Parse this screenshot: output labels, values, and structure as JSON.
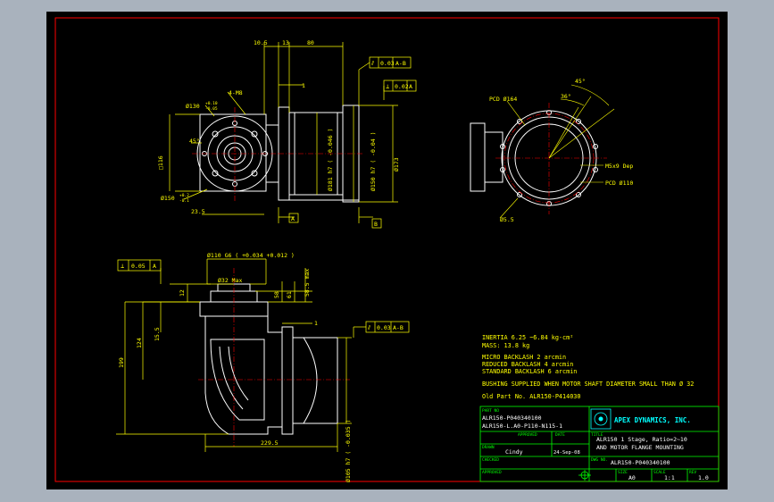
{
  "colors": {
    "background": "#a9b2bd",
    "sheet": "#000000",
    "border": "#ff0000",
    "line": "#ffffff",
    "dimension": "#ffff00",
    "center": "#ff0000",
    "titleblock": "#00ff00",
    "logo": "#00ffff"
  },
  "top_view": {
    "dims": {
      "d_10_5": "10.5",
      "d_13": "13",
      "d_80": "80",
      "d_1": "1",
      "d_4_m8": "4-M8",
      "d_130": "Ø130",
      "d_130_tol_top": "+0.10",
      "d_130_tol_bot": "-0.05",
      "d_45": "45°",
      "d_116": "□116",
      "d_150": "Ø150",
      "d_150_tol_top": "+0.2",
      "d_150_tol_bot": "-0.1",
      "d_23_5": "23.5",
      "d_181_h7": "Ø181 h7 ( -0.046 )",
      "d_150_h7": "Ø150 h7 ( -0.04 )",
      "d_173": "Ø173"
    },
    "fcf_1": {
      "symbol": "⫽",
      "value": "0.03",
      "ref": "A-B"
    },
    "fcf_2": {
      "symbol": "⊥",
      "value": "0.02",
      "ref": "A"
    },
    "datum_a": "A",
    "datum_b": "B"
  },
  "side_view": {
    "dims": {
      "pcd_164": "PCD Ø164",
      "ang_45": "45°",
      "ang_36": "36°",
      "m5": "M5x9 Dep",
      "pcd_110": "PCD Ø110",
      "d_5_5": "Ø5.5"
    }
  },
  "bottom_view": {
    "dims": {
      "d_110_g6": "Ø110 G6 ( +0.034 +0.012 )",
      "d_32": "Ø32 Max",
      "d_58": "58",
      "d_61": "61",
      "d_58_5": "58.5 max",
      "d_12": "12",
      "d_15_5": "15.5",
      "d_124": "124",
      "d_199": "199",
      "d_229_5": "229.5",
      "d_1": "1",
      "d_105": "Ø105 h7 ( -0.035 )"
    },
    "fcf_1": {
      "symbol": "⊥",
      "value": "0.05",
      "ref": "A"
    },
    "fcf_2": {
      "symbol": "⫽",
      "value": "0.03",
      "ref": "A-B"
    }
  },
  "notes": {
    "inertia": "INERTIA   6.25 ~6.84 kg-cm²",
    "mass": "MASS: 13.8 kg",
    "micro": "MICRO BACKLASH 2 arcmin",
    "reduced": "REDUCED BACKLASH 4 arcmin",
    "standard": "STANDARD BACKLASH 6 arcmin",
    "bushing": "BUSHING SUPPLIED WHEN MOTOR SHAFT DIAMETER SMALL THAN Ø 32",
    "old_part": "Old Part No. ALR150-P414030"
  },
  "title_block": {
    "part_no_label": "PART NO",
    "part_no_1": "ALR150-P040340100",
    "part_no_2": "ALR150-L.A0-P110-N115-1",
    "logo_text": "APEX DYNAMICS, INC.",
    "approved_label": "APPROVED",
    "date_label": "DATE",
    "drawn_label": "DRAWN",
    "drawn_value": "Cindy",
    "date_value": "24-Sep-08",
    "title_label": "TITLE",
    "title_1": "ALR150 1 Stage, Ratio=2~10",
    "title_2": "AND MOTOR FLANGE MOUNTING",
    "checked_label": "CHECKED",
    "dwg_label": "DWG NO.",
    "dwg_value": "ALR150-P040340100",
    "approved2_label": "APPROVED",
    "size_label": "SIZE",
    "size_value": "A0",
    "scale_label": "SCALE",
    "scale_value": "1:1",
    "rev_label": "REV",
    "rev_value": "1.0"
  }
}
